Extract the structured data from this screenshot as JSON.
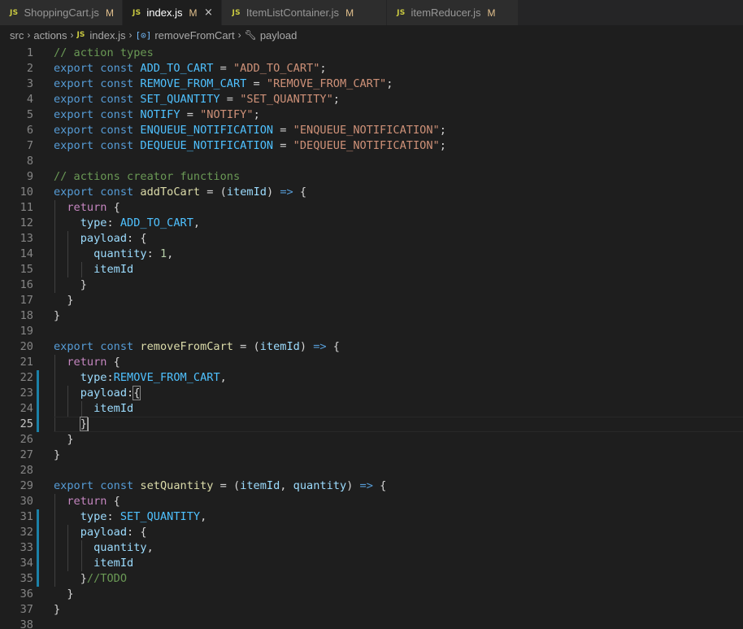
{
  "tabs": [
    {
      "label": "ShoppingCart.js",
      "badge": "M",
      "icon": "JS",
      "active": false
    },
    {
      "label": "index.js",
      "badge": "M",
      "icon": "JS",
      "active": true,
      "close": "×"
    },
    {
      "label": "ItemListContainer.js",
      "badge": "M",
      "icon": "JS",
      "active": false
    },
    {
      "label": "itemReducer.js",
      "badge": "M",
      "icon": "JS",
      "active": false
    }
  ],
  "breadcrumb": {
    "items": [
      "src",
      "actions",
      "index.js",
      "removeFromCart",
      "payload"
    ],
    "file_icon": "JS",
    "symbol_icon": "[⊙]",
    "property_icon": "wrench-icon"
  },
  "editor": {
    "current_line": 25,
    "lines": [
      {
        "n": "1",
        "tokens": [
          [
            "cmt",
            "// action types"
          ]
        ]
      },
      {
        "n": "2",
        "tokens": [
          [
            "kw",
            "export"
          ],
          [
            "pun",
            " "
          ],
          [
            "kw",
            "const"
          ],
          [
            "pun",
            " "
          ],
          [
            "cst",
            "ADD_TO_CART"
          ],
          [
            "pun",
            " = "
          ],
          [
            "str",
            "\"ADD_TO_CART\""
          ],
          [
            "pun",
            ";"
          ]
        ]
      },
      {
        "n": "3",
        "tokens": [
          [
            "kw",
            "export"
          ],
          [
            "pun",
            " "
          ],
          [
            "kw",
            "const"
          ],
          [
            "pun",
            " "
          ],
          [
            "cst",
            "REMOVE_FROM_CART"
          ],
          [
            "pun",
            " = "
          ],
          [
            "str",
            "\"REMOVE_FROM_CART\""
          ],
          [
            "pun",
            ";"
          ]
        ]
      },
      {
        "n": "4",
        "tokens": [
          [
            "kw",
            "export"
          ],
          [
            "pun",
            " "
          ],
          [
            "kw",
            "const"
          ],
          [
            "pun",
            " "
          ],
          [
            "cst",
            "SET_QUANTITY"
          ],
          [
            "pun",
            " = "
          ],
          [
            "str",
            "\"SET_QUANTITY\""
          ],
          [
            "pun",
            ";"
          ]
        ]
      },
      {
        "n": "5",
        "tokens": [
          [
            "kw",
            "export"
          ],
          [
            "pun",
            " "
          ],
          [
            "kw",
            "const"
          ],
          [
            "pun",
            " "
          ],
          [
            "cst",
            "NOTIFY"
          ],
          [
            "pun",
            " = "
          ],
          [
            "str",
            "\"NOTIFY\""
          ],
          [
            "pun",
            ";"
          ]
        ]
      },
      {
        "n": "6",
        "tokens": [
          [
            "kw",
            "export"
          ],
          [
            "pun",
            " "
          ],
          [
            "kw",
            "const"
          ],
          [
            "pun",
            " "
          ],
          [
            "cst",
            "ENQUEUE_NOTIFICATION"
          ],
          [
            "pun",
            " = "
          ],
          [
            "str",
            "\"ENQUEUE_NOTIFICATION\""
          ],
          [
            "pun",
            ";"
          ]
        ]
      },
      {
        "n": "7",
        "tokens": [
          [
            "kw",
            "export"
          ],
          [
            "pun",
            " "
          ],
          [
            "kw",
            "const"
          ],
          [
            "pun",
            " "
          ],
          [
            "cst",
            "DEQUEUE_NOTIFICATION"
          ],
          [
            "pun",
            " = "
          ],
          [
            "str",
            "\"DEQUEUE_NOTIFICATION\""
          ],
          [
            "pun",
            ";"
          ]
        ]
      },
      {
        "n": "8",
        "tokens": []
      },
      {
        "n": "9",
        "tokens": [
          [
            "cmt",
            "// actions creator functions"
          ]
        ]
      },
      {
        "n": "10",
        "tokens": [
          [
            "kw",
            "export"
          ],
          [
            "pun",
            " "
          ],
          [
            "kw",
            "const"
          ],
          [
            "pun",
            " "
          ],
          [
            "fn",
            "addToCart"
          ],
          [
            "pun",
            " = ("
          ],
          [
            "prm",
            "itemId"
          ],
          [
            "pun",
            ") "
          ],
          [
            "kw",
            "=>"
          ],
          [
            "pun",
            " {"
          ]
        ]
      },
      {
        "n": "11",
        "tokens": [
          [
            "pun",
            "  "
          ],
          [
            "ctl",
            "return"
          ],
          [
            "pun",
            " {"
          ]
        ]
      },
      {
        "n": "12",
        "tokens": [
          [
            "pun",
            "    "
          ],
          [
            "prop",
            "type"
          ],
          [
            "pun",
            ": "
          ],
          [
            "cst",
            "ADD_TO_CART"
          ],
          [
            "pun",
            ","
          ]
        ]
      },
      {
        "n": "13",
        "tokens": [
          [
            "pun",
            "    "
          ],
          [
            "prop",
            "payload"
          ],
          [
            "pun",
            ": {"
          ]
        ]
      },
      {
        "n": "14",
        "tokens": [
          [
            "pun",
            "      "
          ],
          [
            "prop",
            "quantity"
          ],
          [
            "pun",
            ": "
          ],
          [
            "num",
            "1"
          ],
          [
            "pun",
            ","
          ]
        ]
      },
      {
        "n": "15",
        "tokens": [
          [
            "pun",
            "      "
          ],
          [
            "prop",
            "itemId"
          ]
        ]
      },
      {
        "n": "16",
        "tokens": [
          [
            "pun",
            "    }"
          ]
        ]
      },
      {
        "n": "17",
        "tokens": [
          [
            "pun",
            "  }"
          ]
        ]
      },
      {
        "n": "18",
        "tokens": [
          [
            "pun",
            "}"
          ]
        ]
      },
      {
        "n": "19",
        "tokens": []
      },
      {
        "n": "20",
        "tokens": [
          [
            "kw",
            "export"
          ],
          [
            "pun",
            " "
          ],
          [
            "kw",
            "const"
          ],
          [
            "pun",
            " "
          ],
          [
            "fn",
            "removeFromCart"
          ],
          [
            "pun",
            " = ("
          ],
          [
            "prm",
            "itemId"
          ],
          [
            "pun",
            ") "
          ],
          [
            "kw",
            "=>"
          ],
          [
            "pun",
            " {"
          ]
        ]
      },
      {
        "n": "21",
        "tokens": [
          [
            "pun",
            "  "
          ],
          [
            "ctl",
            "return"
          ],
          [
            "pun",
            " {"
          ]
        ]
      },
      {
        "n": "22",
        "tokens": [
          [
            "pun",
            "    "
          ],
          [
            "prop",
            "type"
          ],
          [
            "pun",
            ":"
          ],
          [
            "cst",
            "REMOVE_FROM_CART"
          ],
          [
            "pun",
            ","
          ]
        ]
      },
      {
        "n": "23",
        "tokens": [
          [
            "pun",
            "    "
          ],
          [
            "prop",
            "payload"
          ],
          [
            "pun",
            ":"
          ],
          [
            "bm",
            "{"
          ]
        ]
      },
      {
        "n": "24",
        "tokens": [
          [
            "pun",
            "      "
          ],
          [
            "prop",
            "itemId"
          ]
        ]
      },
      {
        "n": "25",
        "tokens": [
          [
            "pun",
            "    "
          ],
          [
            "bm",
            "}"
          ],
          [
            "caret",
            ""
          ]
        ]
      },
      {
        "n": "26",
        "tokens": [
          [
            "pun",
            "  }"
          ]
        ]
      },
      {
        "n": "27",
        "tokens": [
          [
            "pun",
            "}"
          ]
        ]
      },
      {
        "n": "28",
        "tokens": []
      },
      {
        "n": "29",
        "tokens": [
          [
            "kw",
            "export"
          ],
          [
            "pun",
            " "
          ],
          [
            "kw",
            "const"
          ],
          [
            "pun",
            " "
          ],
          [
            "fn",
            "setQuantity"
          ],
          [
            "pun",
            " = ("
          ],
          [
            "prm",
            "itemId"
          ],
          [
            "pun",
            ", "
          ],
          [
            "prm",
            "quantity"
          ],
          [
            "pun",
            ") "
          ],
          [
            "kw",
            "=>"
          ],
          [
            "pun",
            " {"
          ]
        ]
      },
      {
        "n": "30",
        "tokens": [
          [
            "pun",
            "  "
          ],
          [
            "ctl",
            "return"
          ],
          [
            "pun",
            " {"
          ]
        ]
      },
      {
        "n": "31",
        "tokens": [
          [
            "pun",
            "    "
          ],
          [
            "prop",
            "type"
          ],
          [
            "pun",
            ": "
          ],
          [
            "cst",
            "SET_QUANTITY"
          ],
          [
            "pun",
            ","
          ]
        ]
      },
      {
        "n": "32",
        "tokens": [
          [
            "pun",
            "    "
          ],
          [
            "prop",
            "payload"
          ],
          [
            "pun",
            ": {"
          ]
        ]
      },
      {
        "n": "33",
        "tokens": [
          [
            "pun",
            "      "
          ],
          [
            "prop",
            "quantity"
          ],
          [
            "pun",
            ","
          ]
        ]
      },
      {
        "n": "34",
        "tokens": [
          [
            "pun",
            "      "
          ],
          [
            "prop",
            "itemId"
          ]
        ]
      },
      {
        "n": "35",
        "tokens": [
          [
            "pun",
            "    }"
          ],
          [
            "cmt",
            "//TODO"
          ]
        ]
      },
      {
        "n": "36",
        "tokens": [
          [
            "pun",
            "  }"
          ]
        ]
      },
      {
        "n": "37",
        "tokens": [
          [
            "pun",
            "}"
          ]
        ]
      },
      {
        "n": "38",
        "tokens": []
      }
    ],
    "modified_lines": [
      22,
      23,
      24,
      25,
      31,
      32,
      33,
      34,
      35
    ]
  },
  "colors": {
    "background": "#1e1e1e",
    "keyword": "#569cd6",
    "control": "#c586c0",
    "comment": "#6a9955",
    "string": "#ce9178",
    "constant": "#4fc1ff",
    "function": "#dcdcaa",
    "variable": "#9cdcfe",
    "number": "#b5cea8",
    "modified_gutter": "#1b81a8",
    "tab_badge": "#e2c08d",
    "js_icon": "#cbcb41"
  }
}
